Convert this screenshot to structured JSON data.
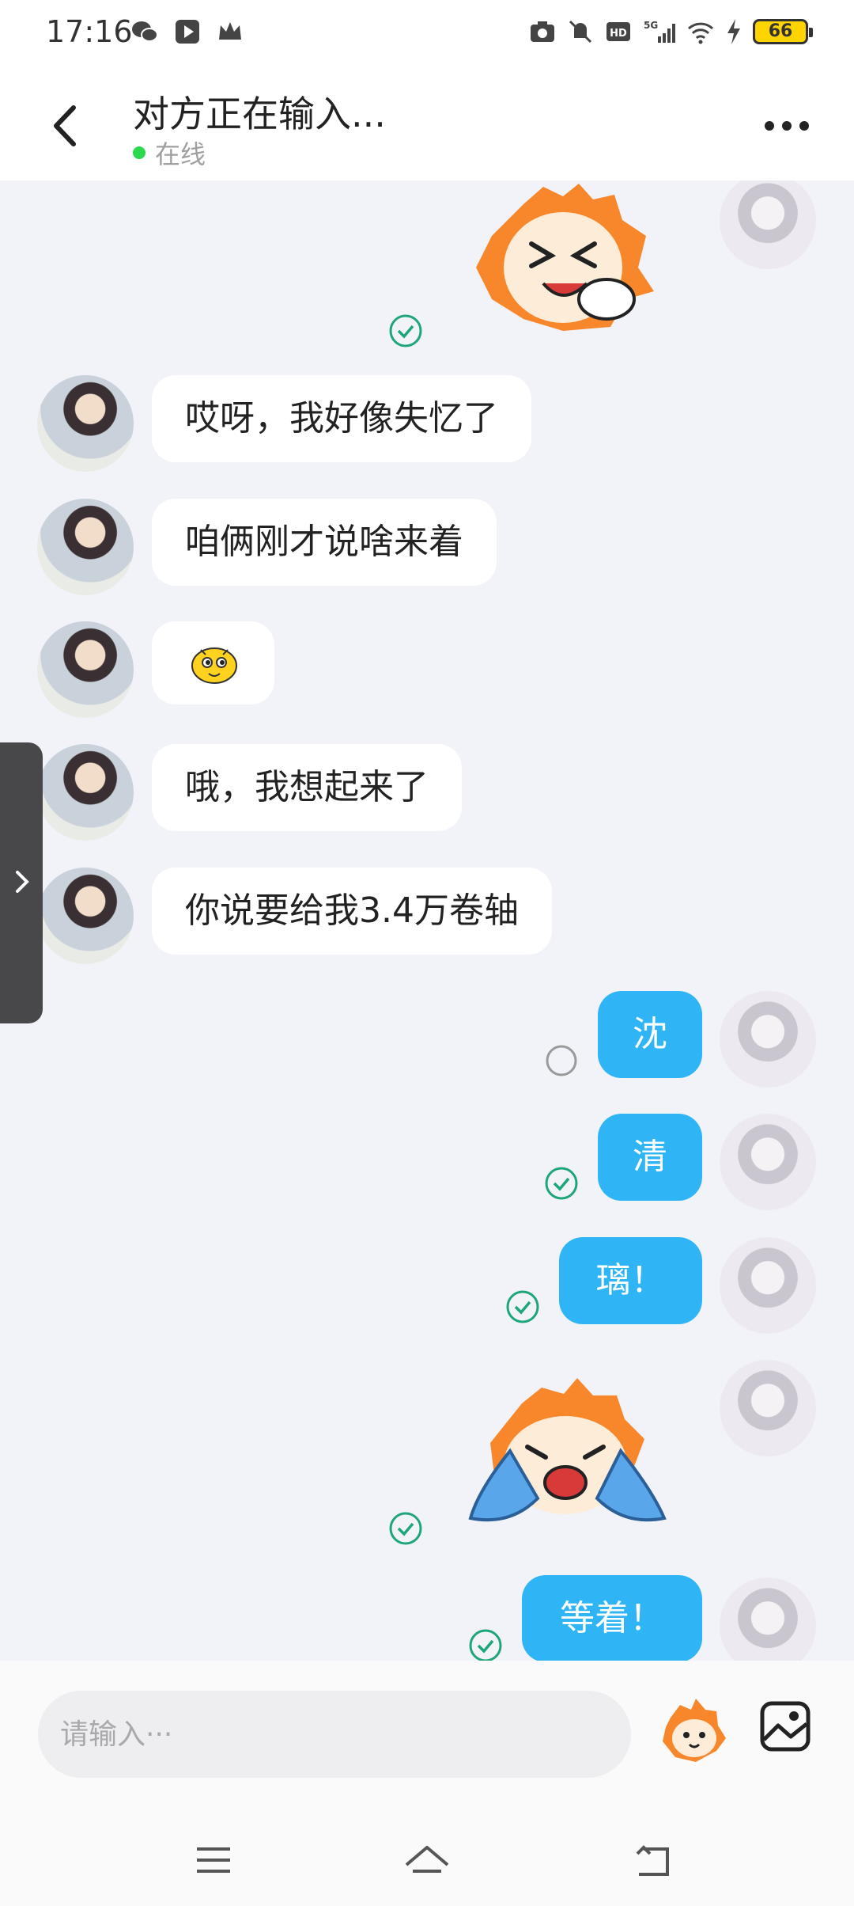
{
  "status_bar": {
    "time": "17:16",
    "left_icons": [
      "wechat-icon",
      "video-play-icon",
      "crown-icon"
    ],
    "right_icons": [
      "camera-icon",
      "mute-icon",
      "hd-icon",
      "5g-signal-icon",
      "wifi-icon",
      "charging-icon"
    ],
    "battery": "66"
  },
  "header": {
    "back_icon": "back-chevron-icon",
    "title": "对方正在输入...",
    "status": "在线",
    "status_color": "#2bd94e",
    "more_icon": "more-dots-icon"
  },
  "messages": [
    {
      "side": "right",
      "type": "sticker",
      "name": "laughing-sticker",
      "status": "read"
    },
    {
      "side": "left",
      "type": "text",
      "text": "哎呀，我好像失忆了"
    },
    {
      "side": "left",
      "type": "text",
      "text": "咱俩刚才说啥来着"
    },
    {
      "side": "left",
      "type": "emoji",
      "name": "yellow-face-emoji"
    },
    {
      "side": "left",
      "type": "text",
      "text": "哦，我想起来了"
    },
    {
      "side": "left",
      "type": "text",
      "text": "你说要给我3.4万卷轴"
    },
    {
      "side": "right",
      "type": "text",
      "text": "沈",
      "status": "sending"
    },
    {
      "side": "right",
      "type": "text",
      "text": "清",
      "status": "read"
    },
    {
      "side": "right",
      "type": "text",
      "text": "璃！",
      "status": "read"
    },
    {
      "side": "right",
      "type": "sticker",
      "name": "crying-sticker",
      "status": "read"
    },
    {
      "side": "right",
      "type": "text",
      "text": "等着！",
      "status": "read"
    }
  ],
  "input_bar": {
    "placeholder": "请输入···",
    "sticker_button_icon": "sticker-face-icon",
    "image_button_icon": "image-icon"
  },
  "nav_bar": {
    "icons": [
      "menu-icon",
      "home-icon",
      "back-icon"
    ]
  },
  "colors": {
    "bubble_self": "#2fb5f5",
    "bubble_other": "#ffffff",
    "chat_background": "#f1f3f9",
    "read_check": "#1ea67a"
  }
}
